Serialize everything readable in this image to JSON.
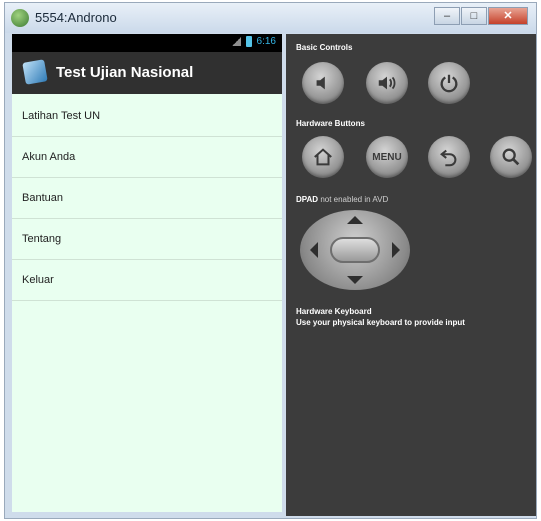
{
  "window": {
    "title": "5554:Androno"
  },
  "device": {
    "status_time": "6:16",
    "app_title": "Test Ujian Nasional",
    "menu_items": [
      "Latihan Test UN",
      "Akun Anda",
      "Bantuan",
      "Tentang",
      "Keluar"
    ]
  },
  "controls": {
    "basic_label": "Basic Controls",
    "hardware_label": "Hardware Buttons",
    "menu_button_label": "MENU",
    "dpad_label_strong": "DPAD",
    "dpad_label_rest": "not enabled in AVD",
    "keyboard_title": "Hardware Keyboard",
    "keyboard_hint": "Use your physical keyboard to provide input"
  },
  "colors": {
    "list_background": "#e9fff0",
    "action_bar": "#303030",
    "panel": "#3c3c3c",
    "clock": "#35b5e5"
  }
}
